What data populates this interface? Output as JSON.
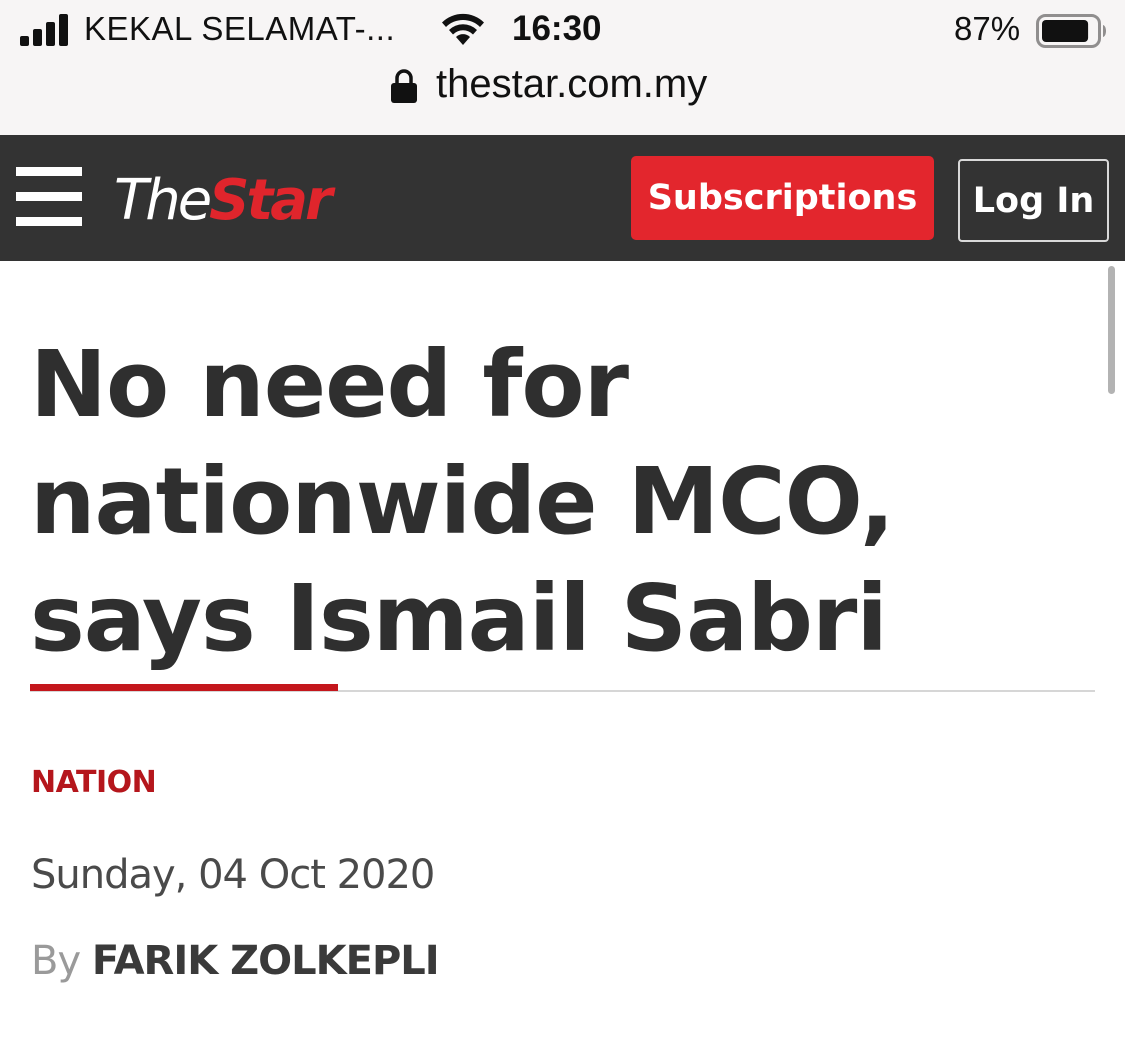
{
  "status_bar": {
    "carrier": "KEKAL SELAMAT-...",
    "time": "16:30",
    "battery_percent": "87%",
    "battery_level": 0.87,
    "icons": [
      "signal-bars-icon",
      "wifi-icon",
      "battery-icon"
    ]
  },
  "browser": {
    "url": "thestar.com.my",
    "secure_icon": "lock-icon"
  },
  "header": {
    "logo_the": "The",
    "logo_star": "Star",
    "menu_icon": "hamburger-menu-icon",
    "subscribe_label": "Subscriptions",
    "login_label": "Log In"
  },
  "article": {
    "headline": "No need for nationwide MCO, says Ismail Sabri",
    "category": "NATION",
    "date": "Sunday, 04 Oct 2020",
    "byline_prefix": "By",
    "author": "FARIK ZOLKEPLI"
  },
  "colors": {
    "header_bg": "#333333",
    "brand_red": "#e3262d",
    "category_red": "#b5161c",
    "headline_text": "#2f2f2f",
    "status_bg": "#f7f5f5"
  }
}
